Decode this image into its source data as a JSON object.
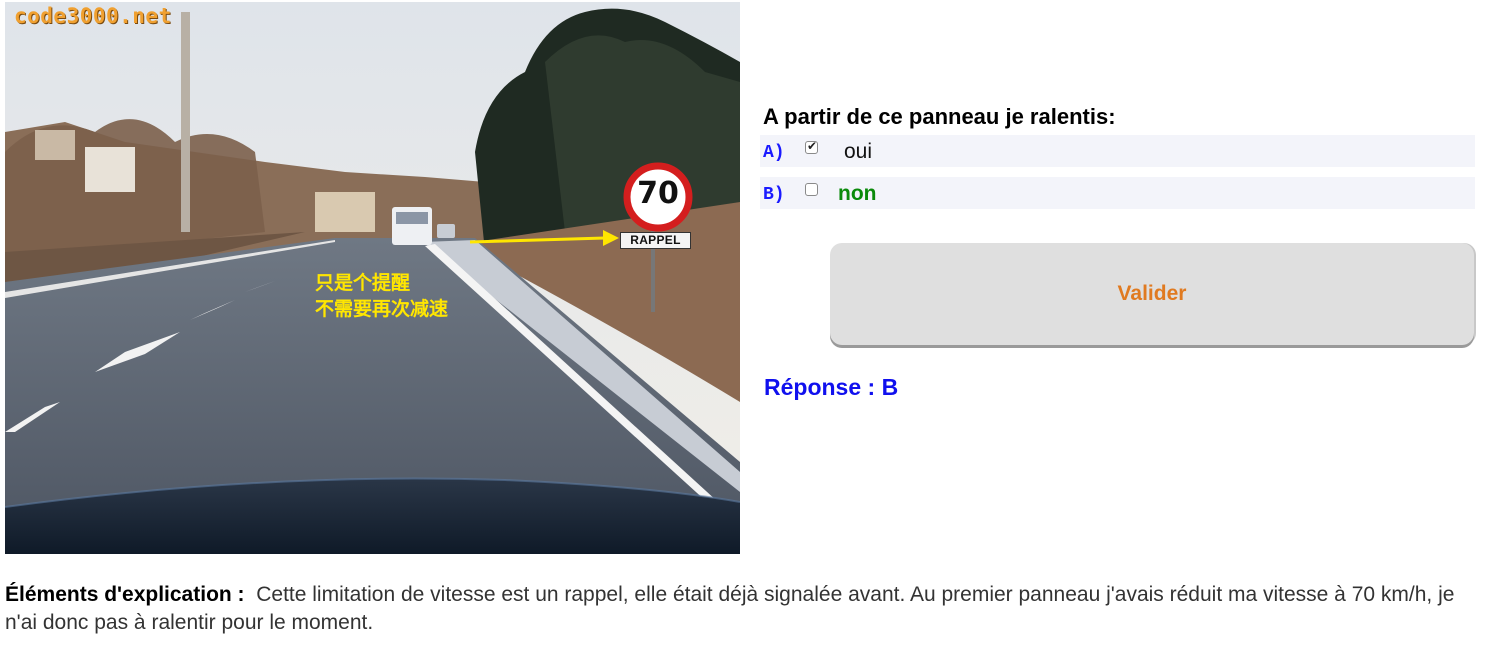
{
  "photo": {
    "watermark": "code3000.net",
    "sign_speed": "70",
    "sign_plate": "RAPPEL",
    "annotation_line1": "只是个提醒",
    "annotation_line2": "不需要再次减速"
  },
  "quiz": {
    "question": "A partir de ce panneau je ralentis:",
    "options": [
      {
        "letter": "A)",
        "text": "oui",
        "checked": true
      },
      {
        "letter": "B)",
        "text": "non",
        "checked": false
      }
    ],
    "validate_label": "Valider",
    "answer": "Réponse : B"
  },
  "explanation": {
    "label": "Éléments d'explication :",
    "text": "Cette limitation de vitesse est un rappel, elle était déjà signalée avant. Au premier panneau j'avais réduit ma vitesse à 70 km/h, je n'ai donc pas à ralentir pour le moment."
  },
  "colors": {
    "watermark": "#f0a030",
    "annotation": "#ffe600",
    "option_letter": "#1a1aff",
    "option_correct": "#0a8a0a",
    "button_text": "#e07a20",
    "answer": "#1010ee"
  }
}
